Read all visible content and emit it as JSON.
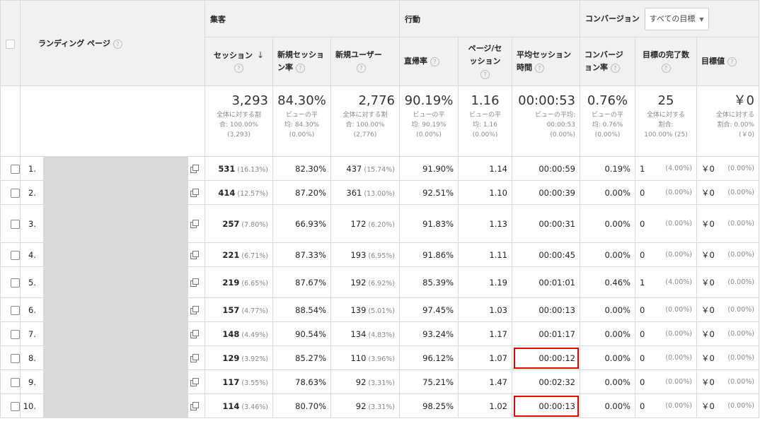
{
  "headers": {
    "landing_page": "ランディング ページ",
    "groups": {
      "acquisition": "集客",
      "behavior": "行動",
      "conversion": "コンバージョン"
    },
    "goal_select": "すべての目標",
    "columns": {
      "sessions": "セッション",
      "new_sessions_a": "新規セッショ",
      "new_sessions_b": "ン率",
      "new_users": "新規ユーザー",
      "bounce": "直帰率",
      "pps_a": "ページ/セ",
      "pps_b": "ッション",
      "avg_a": "平均セッション",
      "avg_b": "時間",
      "conv_a": "コンバージ",
      "conv_b": "ョン率",
      "goal_completions": "目標の完了数",
      "goal_value": "目標値"
    },
    "help": "?"
  },
  "totals": {
    "sessions": {
      "value": "3,293",
      "l1": "全体に対する割",
      "l2": "合: 100.00%",
      "l3": "(3,293)"
    },
    "new_sessions": {
      "value": "84.30%",
      "l1": "ビューの平",
      "l2": "均: 84.30%",
      "l3": "(0.00%)"
    },
    "new_users": {
      "value": "2,776",
      "l1": "全体に対する割",
      "l2": "合: 100.00%",
      "l3": "(2,776)"
    },
    "bounce": {
      "value": "90.19%",
      "l1": "ビューの平",
      "l2": "均: 90.19%",
      "l3": "(0.00%)"
    },
    "pps": {
      "value": "1.16",
      "l1": "ビューの平",
      "l2": "均: 1.16",
      "l3": "(0.00%)"
    },
    "avg": {
      "value": "00:00:53",
      "l1": "ビューの平均:",
      "l2": "00:00:53",
      "l3": "(0.00%)"
    },
    "conv": {
      "value": "0.76%",
      "l1": "ビューの平",
      "l2": "均: 0.76%",
      "l3": "(0.00%)"
    },
    "goal_completions": {
      "value": "25",
      "l1": "全体に対する",
      "l2": "割合:",
      "l3": "100.00% (25)"
    },
    "goal_value": {
      "value": "￥0",
      "l1": "全体に対する",
      "l2": "割合: 0.00%",
      "l3": "(￥0)"
    }
  },
  "rows": [
    {
      "num": "1.",
      "sessions": "531",
      "sessions_pct": "(16.13%)",
      "new_sessions": "82.30%",
      "new_users": "437",
      "new_users_pct": "(15.74%)",
      "bounce": "91.90%",
      "pps": "1.14",
      "avg": "00:00:59",
      "conv": "0.19%",
      "goals": "1",
      "goals_pct": "(4.00%)",
      "value": "￥0",
      "value_pct": "(0.00%)"
    },
    {
      "num": "2.",
      "sessions": "414",
      "sessions_pct": "(12.57%)",
      "new_sessions": "87.20%",
      "new_users": "361",
      "new_users_pct": "(13.00%)",
      "bounce": "92.51%",
      "pps": "1.10",
      "avg": "00:00:39",
      "conv": "0.00%",
      "goals": "0",
      "goals_pct": "(0.00%)",
      "value": "￥0",
      "value_pct": "(0.00%)"
    },
    {
      "num": "3.",
      "sessions": "257",
      "sessions_pct": "(7.80%)",
      "new_sessions": "66.93%",
      "new_users": "172",
      "new_users_pct": "(6.20%)",
      "bounce": "91.83%",
      "pps": "1.13",
      "avg": "00:00:31",
      "conv": "0.00%",
      "goals": "0",
      "goals_pct": "(0.00%)",
      "value": "￥0",
      "value_pct": "(0.00%)"
    },
    {
      "num": "4.",
      "sessions": "221",
      "sessions_pct": "(6.71%)",
      "new_sessions": "87.33%",
      "new_users": "193",
      "new_users_pct": "(6.95%)",
      "bounce": "91.86%",
      "pps": "1.11",
      "avg": "00:00:45",
      "conv": "0.00%",
      "goals": "0",
      "goals_pct": "(0.00%)",
      "value": "￥0",
      "value_pct": "(0.00%)"
    },
    {
      "num": "5.",
      "sessions": "219",
      "sessions_pct": "(6.65%)",
      "new_sessions": "87.67%",
      "new_users": "192",
      "new_users_pct": "(6.92%)",
      "bounce": "85.39%",
      "pps": "1.19",
      "avg": "00:01:01",
      "conv": "0.46%",
      "goals": "1",
      "goals_pct": "(4.00%)",
      "value": "￥0",
      "value_pct": "(0.00%)"
    },
    {
      "num": "6.",
      "sessions": "157",
      "sessions_pct": "(4.77%)",
      "new_sessions": "88.54%",
      "new_users": "139",
      "new_users_pct": "(5.01%)",
      "bounce": "97.45%",
      "pps": "1.03",
      "avg": "00:00:13",
      "conv": "0.00%",
      "goals": "0",
      "goals_pct": "(0.00%)",
      "value": "￥0",
      "value_pct": "(0.00%)"
    },
    {
      "num": "7.",
      "sessions": "148",
      "sessions_pct": "(4.49%)",
      "new_sessions": "90.54%",
      "new_users": "134",
      "new_users_pct": "(4.83%)",
      "bounce": "93.24%",
      "pps": "1.17",
      "avg": "00:01:17",
      "conv": "0.00%",
      "goals": "0",
      "goals_pct": "(0.00%)",
      "value": "￥0",
      "value_pct": "(0.00%)"
    },
    {
      "num": "8.",
      "sessions": "129",
      "sessions_pct": "(3.92%)",
      "new_sessions": "85.27%",
      "new_users": "110",
      "new_users_pct": "(3.96%)",
      "bounce": "96.12%",
      "pps": "1.07",
      "avg": "00:00:12",
      "conv": "0.00%",
      "goals": "0",
      "goals_pct": "(0.00%)",
      "value": "￥0",
      "value_pct": "(0.00%)"
    },
    {
      "num": "9.",
      "sessions": "117",
      "sessions_pct": "(3.55%)",
      "new_sessions": "78.63%",
      "new_users": "92",
      "new_users_pct": "(3.31%)",
      "bounce": "75.21%",
      "pps": "1.47",
      "avg": "00:02:32",
      "conv": "0.00%",
      "goals": "0",
      "goals_pct": "(0.00%)",
      "value": "￥0",
      "value_pct": "(0.00%)"
    },
    {
      "num": "10.",
      "sessions": "114",
      "sessions_pct": "(3.46%)",
      "new_sessions": "80.70%",
      "new_users": "92",
      "new_users_pct": "(3.31%)",
      "bounce": "98.25%",
      "pps": "1.02",
      "avg": "00:00:13",
      "conv": "0.00%",
      "goals": "0",
      "goals_pct": "(0.00%)",
      "value": "￥0",
      "value_pct": "(0.00%)"
    }
  ]
}
